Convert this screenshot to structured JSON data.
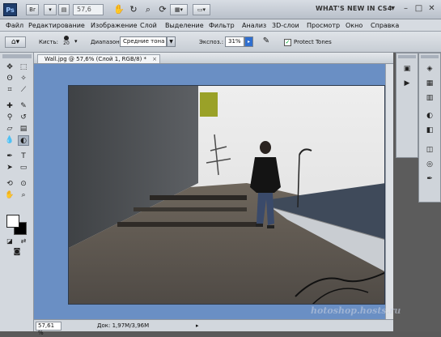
{
  "titlebar": {
    "logo": "Ps",
    "br_button": "Br",
    "zoom_value": "57,6",
    "workspace_title": "WHAT'S NEW IN CS4",
    "icons": [
      "hand-icon",
      "rotate-icon",
      "zoom-icon",
      "grid-icon",
      "screen-mode-icon"
    ],
    "window_buttons": [
      "–",
      "□",
      "✕"
    ]
  },
  "menubar": {
    "items": [
      "Файл",
      "Редактирование",
      "Изображение",
      "Слой",
      "Выделение",
      "Фильтр",
      "Анализ",
      "3D-слои",
      "Просмотр",
      "Окно",
      "Справка"
    ]
  },
  "options": {
    "brush_label": "Кисть:",
    "brush_size": "20",
    "range_label": "Диапазон:",
    "range_value": "Средние тона",
    "exposure_label": "Экспоз.:",
    "exposure_value": "31%",
    "protect_tones_label": "Protect Tones",
    "protect_tones_checked": true
  },
  "document": {
    "tab_title": "Wall.jpg @ 57,6% (Слой 1, RGB/8) *",
    "tab_close": "×"
  },
  "statusbar": {
    "zoom": "57,61 %",
    "doc_info": "Док: 1,97M/3,96M"
  },
  "watermark": "hotoshop.hosts.ru",
  "colors": {
    "canvas_bg": "#6a8fc4",
    "chrome_bg": "#d6dbe1",
    "accent": "#1f3d6b"
  }
}
